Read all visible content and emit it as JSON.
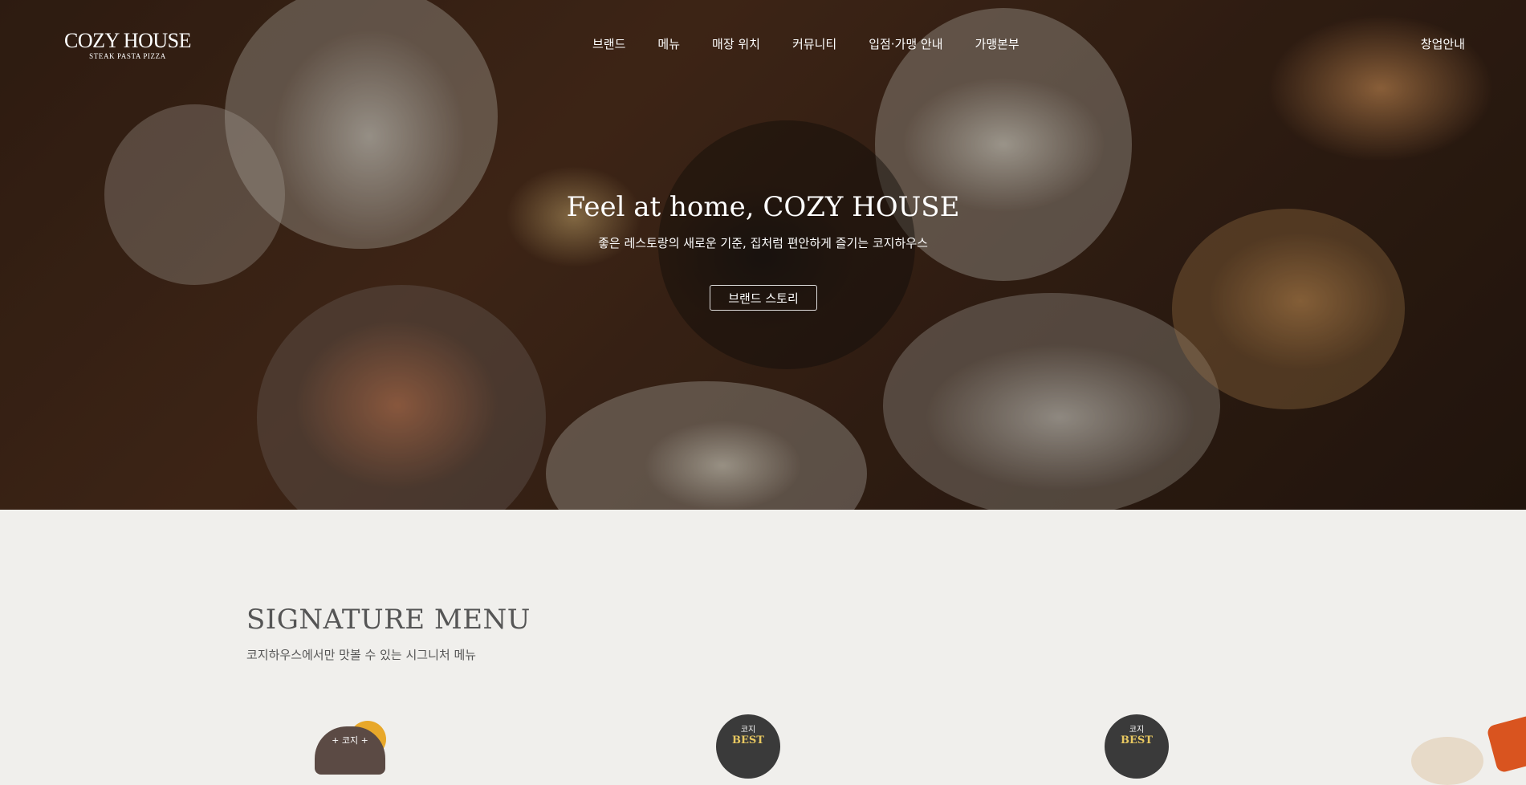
{
  "logo": {
    "main": "COZY HOUSE",
    "sub": "STEAK PASTA PIZZA"
  },
  "nav": {
    "items": [
      "브랜드",
      "메뉴",
      "매장 위치",
      "커뮤니티",
      "입점·가맹 안내",
      "가맹본부"
    ],
    "right": "창업안내"
  },
  "hero": {
    "title": "Feel at home, COZY HOUSE",
    "subtitle": "좋은 레스토랑의 새로운 기준, 집처럼 편안하게 즐기는 코지하우스",
    "button": "브랜드 스토리"
  },
  "signature": {
    "title": "SIGNATURE MENU",
    "subtitle": "코지하우스에서만 맛볼 수 있는 시그니처 메뉴"
  },
  "badges": {
    "new_top": "+ 코지 +",
    "best_top": "코지",
    "best_label": "BEST"
  },
  "colors": {
    "background": "#f0efec",
    "text": "#555555",
    "badge_dark": "#3a3a3a",
    "badge_gold": "#e8c860",
    "accent_orange": "#d9541f"
  }
}
